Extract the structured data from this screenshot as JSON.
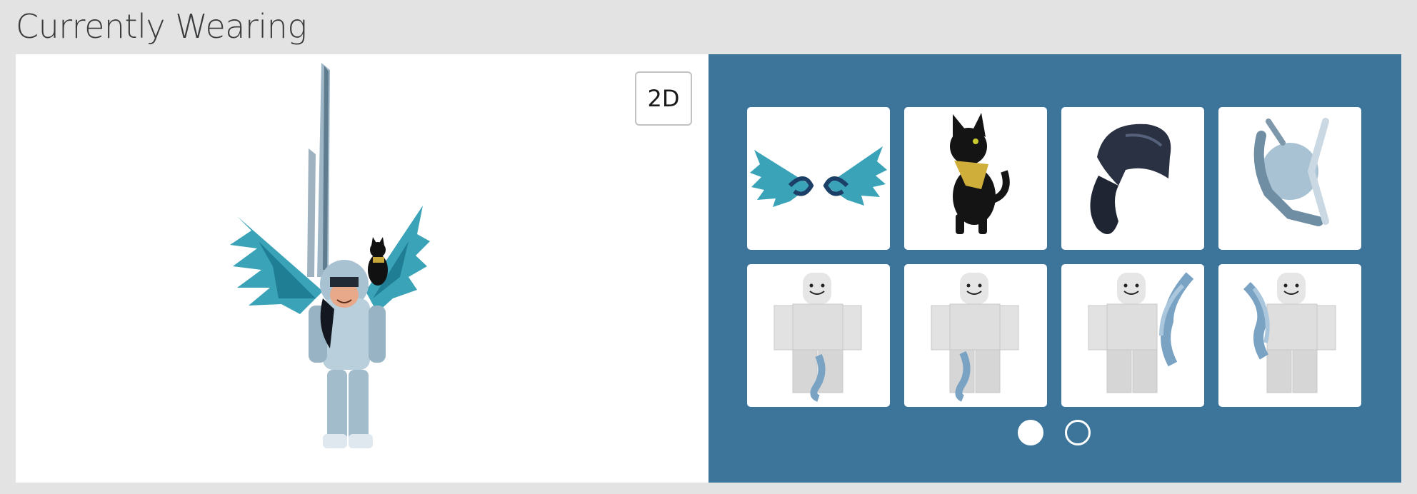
{
  "page": {
    "title": "Currently Wearing"
  },
  "viewer": {
    "toggle_label": "2D"
  },
  "items": [
    {
      "name": "wings-accessory",
      "icon": "wings-icon"
    },
    {
      "name": "black-cat-accessory",
      "icon": "cat-icon"
    },
    {
      "name": "hair-accessory",
      "icon": "hair-icon"
    },
    {
      "name": "helmet-accessory",
      "icon": "helmet-icon"
    },
    {
      "name": "left-leg-body-part",
      "icon": "avatar-left-leg-icon"
    },
    {
      "name": "right-leg-body-part",
      "icon": "avatar-right-leg-icon"
    },
    {
      "name": "right-arm-body-part",
      "icon": "avatar-right-arm-icon"
    },
    {
      "name": "left-arm-body-part",
      "icon": "avatar-left-arm-icon"
    }
  ],
  "pagination": {
    "pages": 2,
    "current": 1
  },
  "colors": {
    "background": "#e3e3e3",
    "items_panel": "#3c7599",
    "card": "#ffffff"
  }
}
